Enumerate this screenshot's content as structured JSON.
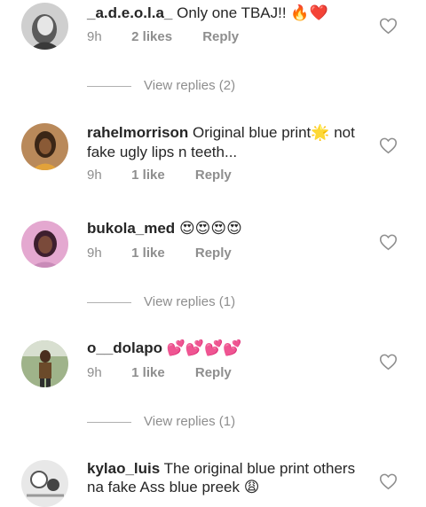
{
  "comments": [
    {
      "username": "_a.d.e.o.l.a_",
      "text": "Only one TBAJ!!",
      "emoji": "🔥❤️",
      "time": "9h",
      "likes": "2 likes",
      "reply": "Reply",
      "view_replies": "View replies (2)"
    },
    {
      "username": "rahelmorrison",
      "text": "Original blue print",
      "emoji": "🌟",
      "text2": "not",
      "line2": "fake ugly lips n teeth...",
      "time": "9h",
      "likes": "1 like",
      "reply": "Reply"
    },
    {
      "username": "bukola_med",
      "text": "",
      "emoji": "😍😍😍😍",
      "time": "9h",
      "likes": "1 like",
      "reply": "Reply",
      "view_replies": "View replies (1)"
    },
    {
      "username": "o__dolapo",
      "text": "",
      "emoji": "💕💕💕💕",
      "time": "9h",
      "likes": "1 like",
      "reply": "Reply",
      "view_replies": "View replies (1)"
    },
    {
      "username": "kylao_luis",
      "text": "The original blue print others",
      "line2": "na fake Ass blue preek",
      "emoji": "😩"
    }
  ],
  "icons": {
    "heart": "heart-outline-icon",
    "avatar": "avatar"
  },
  "colors": {
    "text": "#262626",
    "muted": "#8e8e8e",
    "divider": "#b0b0b0"
  }
}
